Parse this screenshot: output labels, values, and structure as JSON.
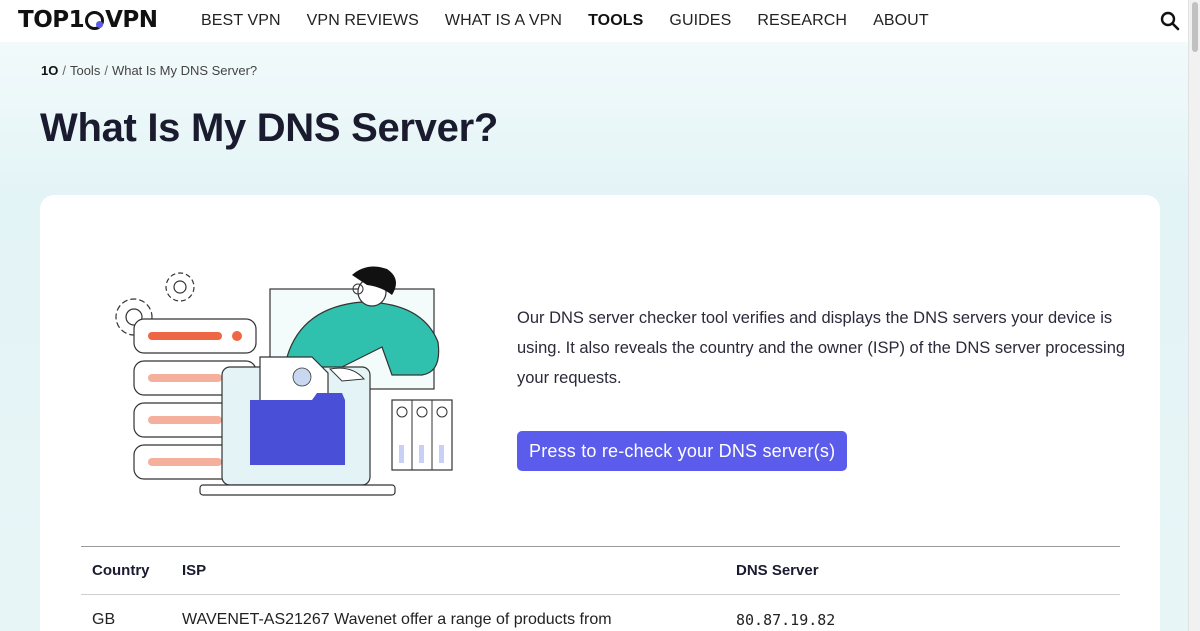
{
  "header": {
    "logo": {
      "prefix": "TOP1",
      "suffix": "VPN"
    },
    "nav": [
      {
        "label": "BEST VPN",
        "active": false
      },
      {
        "label": "VPN REVIEWS",
        "active": false
      },
      {
        "label": "WHAT IS A VPN",
        "active": false
      },
      {
        "label": "TOOLS",
        "active": true
      },
      {
        "label": "GUIDES",
        "active": false
      },
      {
        "label": "RESEARCH",
        "active": false
      },
      {
        "label": "ABOUT",
        "active": false
      }
    ],
    "search_icon": "search-icon"
  },
  "breadcrumb": {
    "home": "1O",
    "items": [
      "Tools",
      "What Is My DNS Server?"
    ]
  },
  "page": {
    "title": "What Is My DNS Server?"
  },
  "tool": {
    "description": "Our DNS server checker tool verifies and displays the DNS servers your device is using. It also reveals the country and the owner (ISP) of the DNS server processing your requests.",
    "button_label": "Press to re-check your DNS server(s)"
  },
  "table": {
    "headers": {
      "country": "Country",
      "isp": "ISP",
      "dns": "DNS Server"
    },
    "rows": [
      {
        "country": "GB",
        "isp": "WAVENET-AS21267 Wavenet offer a range of products from",
        "dns": "80.87.19.82"
      }
    ]
  },
  "colors": {
    "accent": "#5b5cec",
    "teal": "#2fc1ae",
    "coral": "#ee6644",
    "blue": "#4a4fd8"
  }
}
